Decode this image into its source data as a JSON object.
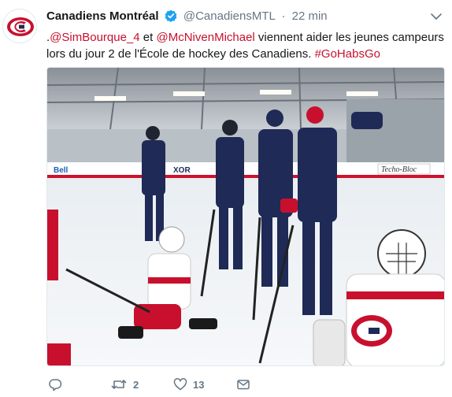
{
  "tweet": {
    "author_name": "Canadiens Montréal",
    "handle": "@CanadiensMTL",
    "separator": "·",
    "time": "22 min",
    "text_lead": ".",
    "mention1": "@SimBourque_4",
    "text_mid": " et ",
    "mention2": "@McNivenMichael",
    "text_body": " viennent aider les jeunes campeurs lors du jour 2 de l'École de hockey des Canadiens. ",
    "hashtag": "#GoHabsGo",
    "media": {
      "banner_brand_left": "Bell",
      "banner_brand_right": "Techo-Bloc",
      "banner_brand_mid": "XOR"
    },
    "actions": {
      "reply_count": "",
      "retweet_count": "2",
      "like_count": "13"
    }
  },
  "colors": {
    "brand": "#c8102e",
    "navy": "#1f2a56",
    "verified": "#1da1f2",
    "muted": "#657786"
  }
}
